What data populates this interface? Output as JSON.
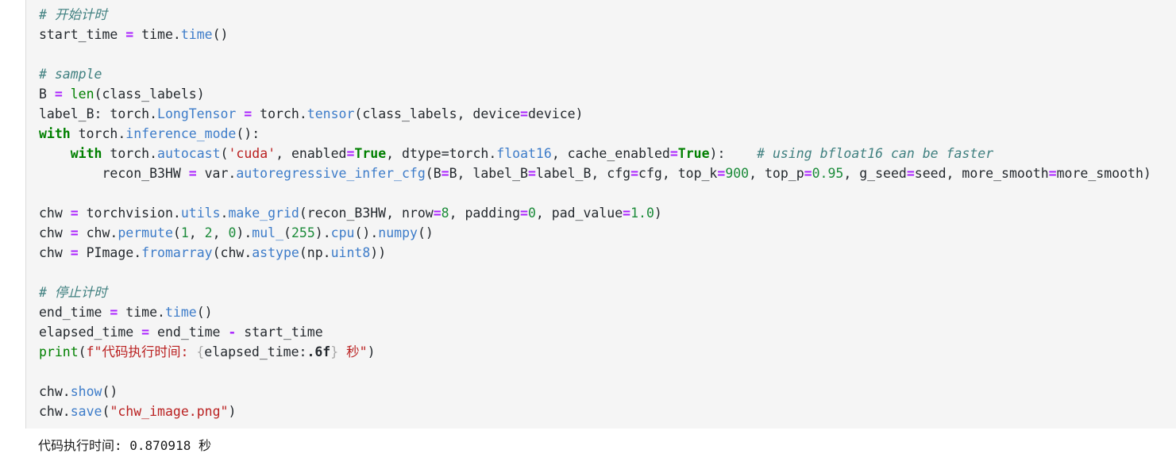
{
  "notebook": {
    "cell_type": "code",
    "language": "python",
    "background_color": "#f5f5f5",
    "output_background_color": "#ffffff"
  },
  "theme": {
    "text": "#24292e",
    "comment": "#408080",
    "keyword": "#008000",
    "builtin": "#008000",
    "function": "#0000ff",
    "attribute": "#3d7cc9",
    "operator": "#aa22ff",
    "number": "#1c8b3a",
    "string": "#ba2121"
  },
  "code": {
    "lines": [
      {
        "id": "l1",
        "text": "# 开始计时"
      },
      {
        "id": "l2",
        "text": "start_time = time.time()"
      },
      {
        "id": "l3",
        "text": ""
      },
      {
        "id": "l4",
        "text": "# sample"
      },
      {
        "id": "l5",
        "text": "B = len(class_labels)"
      },
      {
        "id": "l6",
        "text": "label_B: torch.LongTensor = torch.tensor(class_labels, device=device)"
      },
      {
        "id": "l7",
        "text": "with torch.inference_mode():"
      },
      {
        "id": "l8",
        "text": "    with torch.autocast('cuda', enabled=True, dtype=torch.float16, cache_enabled=True):    # using bfloat16 can be faster"
      },
      {
        "id": "l9",
        "text": "        recon_B3HW = var.autoregressive_infer_cfg(B=B, label_B=label_B, cfg=cfg, top_k=900, top_p=0.95, g_seed=seed, more_smooth=more_smooth)"
      },
      {
        "id": "l10",
        "text": ""
      },
      {
        "id": "l11",
        "text": "chw = torchvision.utils.make_grid(recon_B3HW, nrow=8, padding=0, pad_value=1.0)"
      },
      {
        "id": "l12",
        "text": "chw = chw.permute(1, 2, 0).mul_(255).cpu().numpy()"
      },
      {
        "id": "l13",
        "text": "chw = PImage.fromarray(chw.astype(np.uint8))"
      },
      {
        "id": "l14",
        "text": ""
      },
      {
        "id": "l15",
        "text": "# 停止计时"
      },
      {
        "id": "l16",
        "text": "end_time = time.time()"
      },
      {
        "id": "l17",
        "text": "elapsed_time = end_time - start_time"
      },
      {
        "id": "l18",
        "text": "print(f\"代码执行时间: {elapsed_time:.6f} 秒\")"
      },
      {
        "id": "l19",
        "text": ""
      },
      {
        "id": "l20",
        "text": "chw.show()"
      },
      {
        "id": "l21",
        "text": "chw.save(\"chw_image.png\")"
      }
    ],
    "tokens": {
      "l1": [
        {
          "t": "# 开始计时",
          "c": "t-comment"
        }
      ],
      "l2": [
        {
          "t": "start_time ",
          "c": "t-plain"
        },
        {
          "t": "=",
          "c": "t-op"
        },
        {
          "t": " time.",
          "c": "t-plain"
        },
        {
          "t": "time",
          "c": "t-attr"
        },
        {
          "t": "()",
          "c": "t-plain"
        }
      ],
      "l3": [],
      "l4": [
        {
          "t": "# sample",
          "c": "t-comment"
        }
      ],
      "l5": [
        {
          "t": "B ",
          "c": "t-plain"
        },
        {
          "t": "=",
          "c": "t-op"
        },
        {
          "t": " ",
          "c": "t-plain"
        },
        {
          "t": "len",
          "c": "t-builtin"
        },
        {
          "t": "(class_labels)",
          "c": "t-plain"
        }
      ],
      "l6": [
        {
          "t": "label_B: torch.",
          "c": "t-plain"
        },
        {
          "t": "LongTensor",
          "c": "t-attr"
        },
        {
          "t": " ",
          "c": "t-plain"
        },
        {
          "t": "=",
          "c": "t-op"
        },
        {
          "t": " torch.",
          "c": "t-plain"
        },
        {
          "t": "tensor",
          "c": "t-attr"
        },
        {
          "t": "(class_labels, device",
          "c": "t-plain"
        },
        {
          "t": "=",
          "c": "t-op"
        },
        {
          "t": "device)",
          "c": "t-plain"
        }
      ],
      "l7": [
        {
          "t": "with",
          "c": "t-kw"
        },
        {
          "t": " torch.",
          "c": "t-plain"
        },
        {
          "t": "inference_mode",
          "c": "t-attr"
        },
        {
          "t": "():",
          "c": "t-plain"
        }
      ],
      "l8": [
        {
          "t": "    ",
          "c": "t-plain"
        },
        {
          "t": "with",
          "c": "t-kw"
        },
        {
          "t": " torch.",
          "c": "t-plain"
        },
        {
          "t": "autocast",
          "c": "t-attr"
        },
        {
          "t": "(",
          "c": "t-plain"
        },
        {
          "t": "'cuda'",
          "c": "t-str"
        },
        {
          "t": ", enabled",
          "c": "t-plain"
        },
        {
          "t": "=",
          "c": "t-op"
        },
        {
          "t": "True",
          "c": "t-kw"
        },
        {
          "t": ", dtype",
          "c": "t-plain"
        },
        {
          "t": "=",
          "c": "t-plain"
        },
        {
          "t": "torch.",
          "c": "t-plain"
        },
        {
          "t": "float16",
          "c": "t-attr"
        },
        {
          "t": ", cache_enabled",
          "c": "t-plain"
        },
        {
          "t": "=",
          "c": "t-op"
        },
        {
          "t": "True",
          "c": "t-kw"
        },
        {
          "t": "):",
          "c": "t-plain"
        },
        {
          "t": "    # using bfloat16 can be faster",
          "c": "t-comment"
        }
      ],
      "l9": [
        {
          "t": "        recon_B3HW ",
          "c": "t-plain"
        },
        {
          "t": "=",
          "c": "t-op"
        },
        {
          "t": " var.",
          "c": "t-plain"
        },
        {
          "t": "autoregressive_infer_cfg",
          "c": "t-attr"
        },
        {
          "t": "(B",
          "c": "t-plain"
        },
        {
          "t": "=",
          "c": "t-op"
        },
        {
          "t": "B, label_B",
          "c": "t-plain"
        },
        {
          "t": "=",
          "c": "t-op"
        },
        {
          "t": "label_B, cfg",
          "c": "t-plain"
        },
        {
          "t": "=",
          "c": "t-op"
        },
        {
          "t": "cfg, top_k",
          "c": "t-plain"
        },
        {
          "t": "=",
          "c": "t-op"
        },
        {
          "t": "900",
          "c": "t-num"
        },
        {
          "t": ", top_p",
          "c": "t-plain"
        },
        {
          "t": "=",
          "c": "t-op"
        },
        {
          "t": "0.95",
          "c": "t-num"
        },
        {
          "t": ", g_seed",
          "c": "t-plain"
        },
        {
          "t": "=",
          "c": "t-op"
        },
        {
          "t": "seed, more_smooth",
          "c": "t-plain"
        },
        {
          "t": "=",
          "c": "t-op"
        },
        {
          "t": "more_smooth)",
          "c": "t-plain"
        }
      ],
      "l10": [],
      "l11": [
        {
          "t": "chw ",
          "c": "t-plain"
        },
        {
          "t": "=",
          "c": "t-op"
        },
        {
          "t": " torchvision.",
          "c": "t-plain"
        },
        {
          "t": "utils",
          "c": "t-attr"
        },
        {
          "t": ".",
          "c": "t-plain"
        },
        {
          "t": "make_grid",
          "c": "t-attr"
        },
        {
          "t": "(recon_B3HW, nrow",
          "c": "t-plain"
        },
        {
          "t": "=",
          "c": "t-op"
        },
        {
          "t": "8",
          "c": "t-num"
        },
        {
          "t": ", padding",
          "c": "t-plain"
        },
        {
          "t": "=",
          "c": "t-op"
        },
        {
          "t": "0",
          "c": "t-num"
        },
        {
          "t": ", pad_value",
          "c": "t-plain"
        },
        {
          "t": "=",
          "c": "t-op"
        },
        {
          "t": "1.0",
          "c": "t-num"
        },
        {
          "t": ")",
          "c": "t-plain"
        }
      ],
      "l12": [
        {
          "t": "chw ",
          "c": "t-plain"
        },
        {
          "t": "=",
          "c": "t-op"
        },
        {
          "t": " chw.",
          "c": "t-plain"
        },
        {
          "t": "permute",
          "c": "t-attr"
        },
        {
          "t": "(",
          "c": "t-plain"
        },
        {
          "t": "1",
          "c": "t-num"
        },
        {
          "t": ", ",
          "c": "t-plain"
        },
        {
          "t": "2",
          "c": "t-num"
        },
        {
          "t": ", ",
          "c": "t-plain"
        },
        {
          "t": "0",
          "c": "t-num"
        },
        {
          "t": ").",
          "c": "t-plain"
        },
        {
          "t": "mul_",
          "c": "t-attr"
        },
        {
          "t": "(",
          "c": "t-plain"
        },
        {
          "t": "255",
          "c": "t-num"
        },
        {
          "t": ").",
          "c": "t-plain"
        },
        {
          "t": "cpu",
          "c": "t-attr"
        },
        {
          "t": "().",
          "c": "t-plain"
        },
        {
          "t": "numpy",
          "c": "t-attr"
        },
        {
          "t": "()",
          "c": "t-plain"
        }
      ],
      "l13": [
        {
          "t": "chw ",
          "c": "t-plain"
        },
        {
          "t": "=",
          "c": "t-op"
        },
        {
          "t": " PImage.",
          "c": "t-plain"
        },
        {
          "t": "fromarray",
          "c": "t-attr"
        },
        {
          "t": "(chw.",
          "c": "t-plain"
        },
        {
          "t": "astype",
          "c": "t-attr"
        },
        {
          "t": "(np.",
          "c": "t-plain"
        },
        {
          "t": "uint8",
          "c": "t-attr"
        },
        {
          "t": "))",
          "c": "t-plain"
        }
      ],
      "l14": [],
      "l15": [
        {
          "t": "# 停止计时",
          "c": "t-comment"
        }
      ],
      "l16": [
        {
          "t": "end_time ",
          "c": "t-plain"
        },
        {
          "t": "=",
          "c": "t-op"
        },
        {
          "t": " time.",
          "c": "t-plain"
        },
        {
          "t": "time",
          "c": "t-attr"
        },
        {
          "t": "()",
          "c": "t-plain"
        }
      ],
      "l17": [
        {
          "t": "elapsed_time ",
          "c": "t-plain"
        },
        {
          "t": "=",
          "c": "t-op"
        },
        {
          "t": " end_time ",
          "c": "t-plain"
        },
        {
          "t": "-",
          "c": "t-op"
        },
        {
          "t": " start_time",
          "c": "t-plain"
        }
      ],
      "l18": [
        {
          "t": "print",
          "c": "t-builtin"
        },
        {
          "t": "(",
          "c": "t-plain"
        },
        {
          "t": "f\"代码执行时间: ",
          "c": "t-str"
        },
        {
          "t": "{",
          "c": "t-fsub"
        },
        {
          "t": "elapsed_time:",
          "c": "t-fsubtxt"
        },
        {
          "t": ".6f",
          "c": "t-fmt"
        },
        {
          "t": "}",
          "c": "t-fsub"
        },
        {
          "t": " 秒\"",
          "c": "t-str"
        },
        {
          "t": ")",
          "c": "t-plain"
        }
      ],
      "l19": [],
      "l20": [
        {
          "t": "chw.",
          "c": "t-plain"
        },
        {
          "t": "show",
          "c": "t-attr"
        },
        {
          "t": "()",
          "c": "t-plain"
        }
      ],
      "l21": [
        {
          "t": "chw.",
          "c": "t-plain"
        },
        {
          "t": "save",
          "c": "t-attr"
        },
        {
          "t": "(",
          "c": "t-plain"
        },
        {
          "t": "\"chw_image.png\"",
          "c": "t-str"
        },
        {
          "t": ")",
          "c": "t-plain"
        }
      ]
    }
  },
  "output": {
    "stream": "stdout",
    "text": "代码执行时间: 0.870918 秒",
    "label": "代码执行时间:",
    "elapsed_seconds": "0.870918",
    "unit": "秒"
  }
}
